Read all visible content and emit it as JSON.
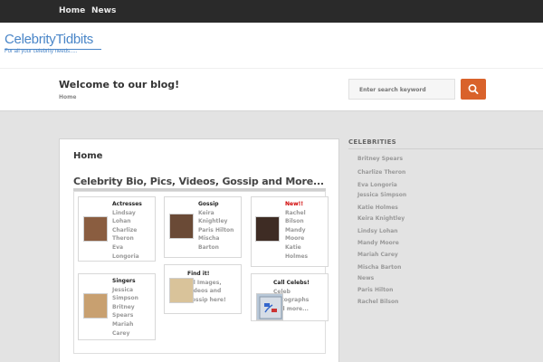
{
  "nav": {
    "items": [
      "Home",
      "News"
    ]
  },
  "logo": {
    "name": "CelebrityTidbits",
    "tagline": "For all your celebrity needs....."
  },
  "banner": {
    "title": "Welcome to our blog!",
    "breadcrumb": "Home"
  },
  "search": {
    "placeholder": "Enter search keyword"
  },
  "main": {
    "title": "Home",
    "subtitle": "Celebrity Bio, Pics, Videos, Gossip and More...",
    "cards": [
      {
        "title": "Actresses",
        "lines": [
          "Lindsay",
          "Lohan",
          "Charlize",
          "Theron",
          "Eva",
          "Longoria"
        ]
      },
      {
        "title": "Gossip",
        "lines": [
          "Keira",
          "Knightley",
          "Paris Hilton",
          "Mischa",
          "Barton"
        ]
      },
      {
        "title": "New!!",
        "lines": [
          "Rachel",
          "Bilson",
          "Mandy",
          "Moore",
          "Katie",
          "Holmes"
        ]
      },
      {
        "title": "Singers",
        "lines": [
          "Jessica",
          "Simpson",
          "Britney",
          "Spears",
          "Mariah",
          "Carey"
        ]
      },
      {
        "title": "Find it!",
        "lines": [
          "All Images,",
          "Videos and",
          "Gossip here!"
        ]
      },
      {
        "title": "Call Celebs!",
        "lines": [
          "Celeb",
          "Autographs",
          "and more..."
        ]
      }
    ]
  },
  "sidebar": {
    "heading": "CELEBRITIES",
    "items": [
      "Britney Spears",
      "Charlize Theron",
      "Eva Longoria",
      "Jessica Simpson",
      "Katie Holmes",
      "Keira Knightley",
      "Lindsy Lohan",
      "Mandy Moore",
      "Mariah Carey",
      "Mischa Barton",
      "News",
      "Paris Hilton",
      "Rachel Bilson"
    ]
  },
  "colors": {
    "topbar": "#2a2a2a",
    "logo_blue": "#4a86c8",
    "search_button": "#d9622b",
    "new_red": "#d00000"
  }
}
